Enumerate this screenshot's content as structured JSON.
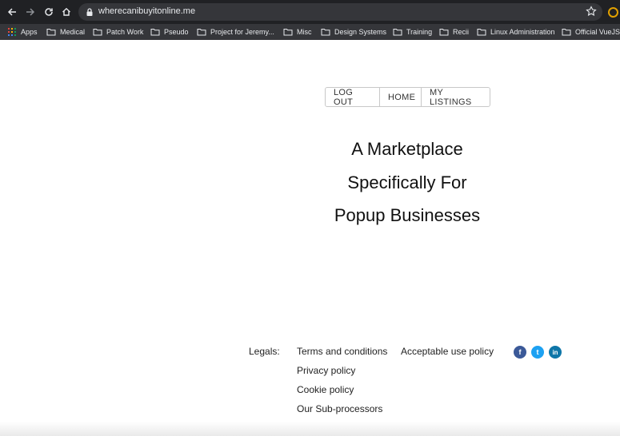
{
  "browser": {
    "url": "wherecanibuyitonline.me",
    "bookmarks": {
      "apps": "Apps",
      "medical": "Medical",
      "patch_work": "Patch Work",
      "pseudo": "Pseudo",
      "project": "Project for Jeremy...",
      "misc": "Misc",
      "design_systems": "Design Systems",
      "training": "Training",
      "recii": "Recii",
      "linux": "Linux Administration",
      "vuejs": "Official VueJS"
    }
  },
  "nav": {
    "logout": "LOG OUT",
    "home": "HOME",
    "listings": "MY LISTINGS"
  },
  "hero": {
    "line1": "A Marketplace",
    "line2": "Specifically For",
    "line3": "Popup Businesses"
  },
  "footer": {
    "legals": "Legals:",
    "terms": "Terms and conditions",
    "acceptable": "Acceptable use policy",
    "privacy": "Privacy policy",
    "cookie": "Cookie policy",
    "subprocessors": "Our Sub-processors"
  },
  "social": {
    "facebook": "f",
    "twitter": "t",
    "linkedin": "in"
  },
  "colors": {
    "facebook": "#3b5998",
    "twitter": "#1da1f2",
    "linkedin": "#0e76a8"
  }
}
